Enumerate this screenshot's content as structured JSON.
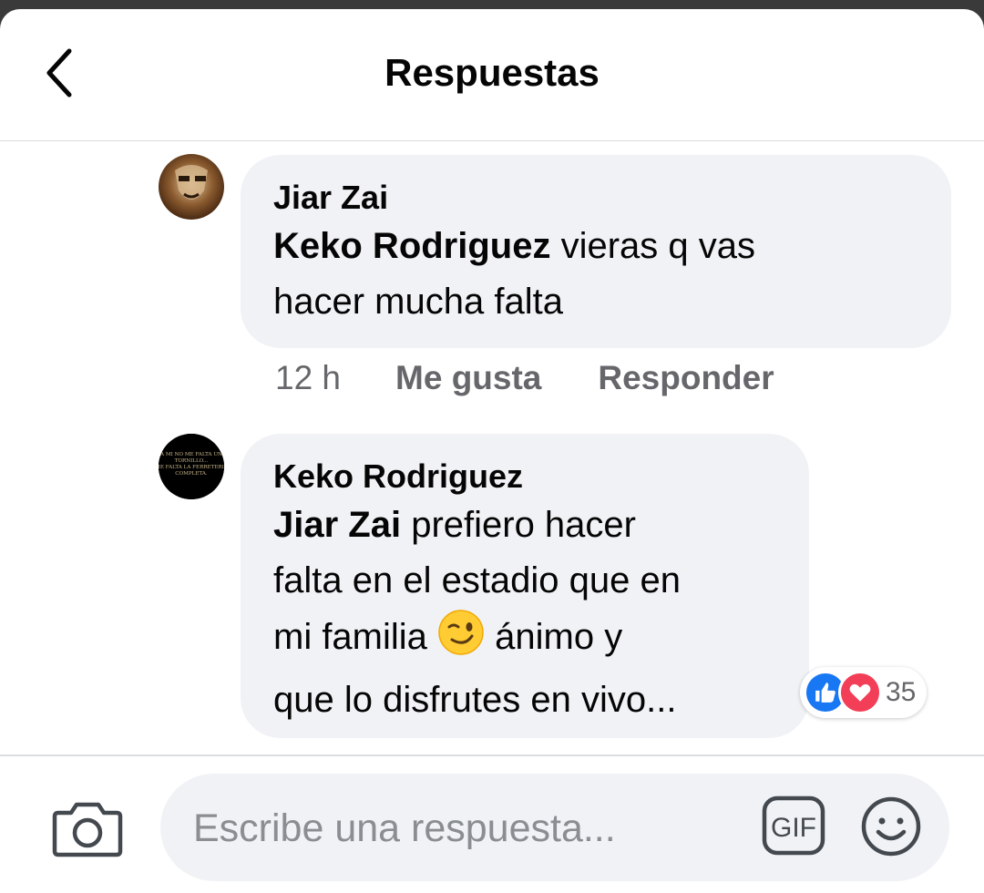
{
  "header": {
    "title": "Respuestas",
    "back_icon": "chevron-left-icon"
  },
  "comments": [
    {
      "author": "Jiar Zai",
      "mention": "Keko Rodriguez",
      "text_line1": " vieras q vas",
      "text_line2": "hacer mucha falta",
      "time": "12 h",
      "like_label": "Me gusta",
      "reply_label": "Responder"
    },
    {
      "author": "Keko Rodriguez",
      "avatar_text": "A MI NO ME FALTA UN TORNILLO... ME FALTA LA FERRETERIA COMPLETA.",
      "mention": "Jiar Zai",
      "text_line1": " prefiero hacer",
      "text_line2": "falta en el estadio que en",
      "text_line3_a": "mi familia ",
      "emoji": "winking-face-icon",
      "text_line3_b": " ánimo y",
      "text_line4": "que lo disfrutes en vivo...",
      "reactions": {
        "icons": [
          "like-icon",
          "love-icon"
        ],
        "count": "35"
      }
    }
  ],
  "composer": {
    "placeholder": "Escribe una respuesta...",
    "gif_label": "GIF",
    "camera_icon": "camera-icon",
    "emoji_icon": "smiley-icon"
  },
  "colors": {
    "bubble": "#f0f2f5",
    "meta_text": "#65676b",
    "like_blue": "#1877f2",
    "love_red": "#f33e58"
  }
}
